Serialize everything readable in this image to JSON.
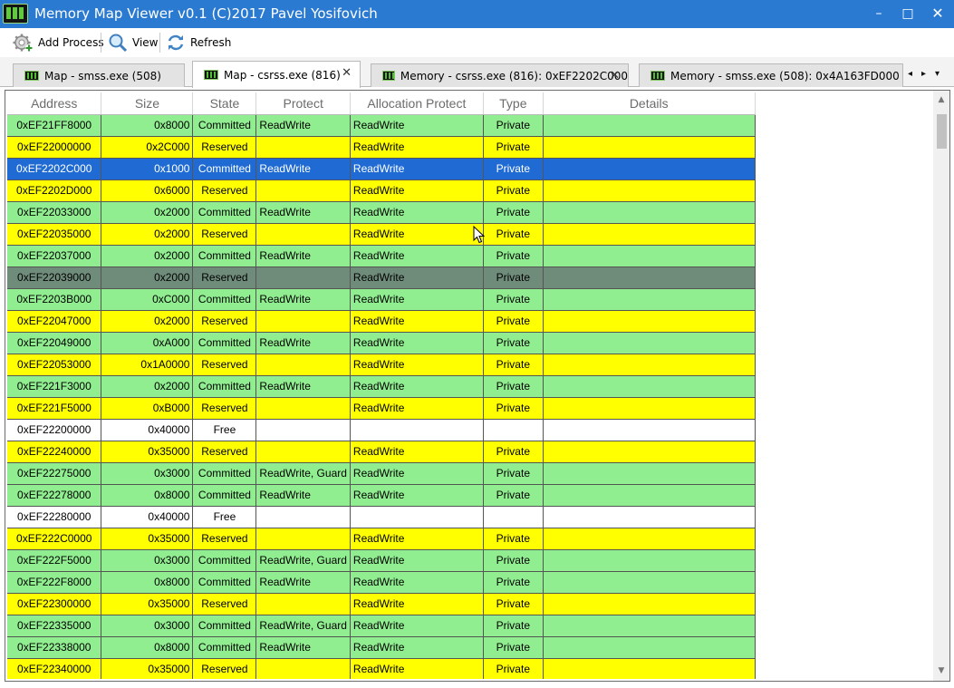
{
  "window": {
    "title": "Memory Map Viewer v0.1 (C)2017 Pavel Yosifovich",
    "minimize_glyph": "–",
    "maximize_glyph": "□",
    "close_glyph": "✕"
  },
  "toolbar": {
    "add_process_label": "Add Process",
    "view_label": "View",
    "refresh_label": "Refresh"
  },
  "tabs": [
    {
      "label": "Map - smss.exe (508)",
      "active": false,
      "icon": "memory-chip-icon"
    },
    {
      "label": "Map - csrss.exe (816)",
      "active": true,
      "icon": "memory-chip-icon"
    },
    {
      "label": "Memory - csrss.exe (816): 0xEF2202C000",
      "active": false,
      "icon": "memory-chip-icon"
    },
    {
      "label": "Memory - smss.exe (508): 0x4A163FD000",
      "active": false,
      "icon": "memory-chip-icon"
    }
  ],
  "tab_close_glyph": "✕",
  "tab_nav": {
    "left": "◂",
    "right": "▸",
    "menu": "▾"
  },
  "grid": {
    "columns": [
      "Address",
      "Size",
      "State",
      "Protect",
      "Allocation Protect",
      "Type",
      "Details"
    ],
    "rows": [
      [
        "0xEF21FF8000",
        "0x8000",
        "Committed",
        "ReadWrite",
        "ReadWrite",
        "Private",
        ""
      ],
      [
        "0xEF22000000",
        "0x2C000",
        "Reserved",
        "",
        "ReadWrite",
        "Private",
        ""
      ],
      [
        "0xEF2202C000",
        "0x1000",
        "Committed",
        "ReadWrite",
        "ReadWrite",
        "Private",
        ""
      ],
      [
        "0xEF2202D000",
        "0x6000",
        "Reserved",
        "",
        "ReadWrite",
        "Private",
        ""
      ],
      [
        "0xEF22033000",
        "0x2000",
        "Committed",
        "ReadWrite",
        "ReadWrite",
        "Private",
        ""
      ],
      [
        "0xEF22035000",
        "0x2000",
        "Reserved",
        "",
        "ReadWrite",
        "Private",
        ""
      ],
      [
        "0xEF22037000",
        "0x2000",
        "Committed",
        "ReadWrite",
        "ReadWrite",
        "Private",
        ""
      ],
      [
        "0xEF22039000",
        "0x2000",
        "Reserved",
        "",
        "ReadWrite",
        "Private",
        ""
      ],
      [
        "0xEF2203B000",
        "0xC000",
        "Committed",
        "ReadWrite",
        "ReadWrite",
        "Private",
        ""
      ],
      [
        "0xEF22047000",
        "0x2000",
        "Reserved",
        "",
        "ReadWrite",
        "Private",
        ""
      ],
      [
        "0xEF22049000",
        "0xA000",
        "Committed",
        "ReadWrite",
        "ReadWrite",
        "Private",
        ""
      ],
      [
        "0xEF22053000",
        "0x1A0000",
        "Reserved",
        "",
        "ReadWrite",
        "Private",
        ""
      ],
      [
        "0xEF221F3000",
        "0x2000",
        "Committed",
        "ReadWrite",
        "ReadWrite",
        "Private",
        ""
      ],
      [
        "0xEF221F5000",
        "0xB000",
        "Reserved",
        "",
        "ReadWrite",
        "Private",
        ""
      ],
      [
        "0xEF22200000",
        "0x40000",
        "Free",
        "",
        "",
        "",
        ""
      ],
      [
        "0xEF22240000",
        "0x35000",
        "Reserved",
        "",
        "ReadWrite",
        "Private",
        ""
      ],
      [
        "0xEF22275000",
        "0x3000",
        "Committed",
        "ReadWrite, Guard",
        "ReadWrite",
        "Private",
        ""
      ],
      [
        "0xEF22278000",
        "0x8000",
        "Committed",
        "ReadWrite",
        "ReadWrite",
        "Private",
        ""
      ],
      [
        "0xEF22280000",
        "0x40000",
        "Free",
        "",
        "",
        "",
        ""
      ],
      [
        "0xEF222C0000",
        "0x35000",
        "Reserved",
        "",
        "ReadWrite",
        "Private",
        ""
      ],
      [
        "0xEF222F5000",
        "0x3000",
        "Committed",
        "ReadWrite, Guard",
        "ReadWrite",
        "Private",
        ""
      ],
      [
        "0xEF222F8000",
        "0x8000",
        "Committed",
        "ReadWrite",
        "ReadWrite",
        "Private",
        ""
      ],
      [
        "0xEF22300000",
        "0x35000",
        "Reserved",
        "",
        "ReadWrite",
        "Private",
        ""
      ],
      [
        "0xEF22335000",
        "0x3000",
        "Committed",
        "ReadWrite, Guard",
        "ReadWrite",
        "Private",
        ""
      ],
      [
        "0xEF22338000",
        "0x8000",
        "Committed",
        "ReadWrite",
        "ReadWrite",
        "Private",
        ""
      ],
      [
        "0xEF22340000",
        "0x35000",
        "Reserved",
        "",
        "ReadWrite",
        "Private",
        ""
      ]
    ],
    "selected_row_index": 2,
    "hover_row_index": 7
  },
  "colors": {
    "titlebar": "#2b7ad1",
    "committed": "#90ee90",
    "reserved": "#ffff00",
    "free": "#ffffff",
    "selected": "#1f6bd3",
    "hover": "#6f8c7b"
  }
}
